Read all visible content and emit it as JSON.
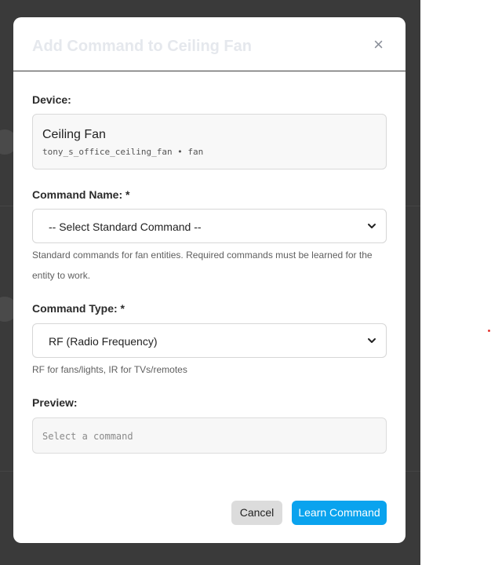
{
  "modal": {
    "title": "Add Command to Ceiling Fan",
    "close_glyph": "×"
  },
  "device": {
    "label": "Device:",
    "name": "Ceiling Fan",
    "meta": "tony_s_office_ceiling_fan • fan"
  },
  "command_name": {
    "label": "Command Name: *",
    "selected": "-- Select Standard Command --",
    "help": "Standard commands for fan entities. Required commands must be learned for the entity to work."
  },
  "command_type": {
    "label": "Command Type: *",
    "selected": "RF (Radio Frequency)",
    "help": "RF for fans/lights, IR for TVs/remotes"
  },
  "preview": {
    "label": "Preview:",
    "placeholder": "Select a command"
  },
  "buttons": {
    "cancel": "Cancel",
    "learn": "Learn Command"
  },
  "colors": {
    "accent": "#0aa3ee",
    "overlay": "#3a3a3a"
  },
  "icons": {
    "close": "close-icon",
    "select_arrow": "chevron-down-icon"
  }
}
